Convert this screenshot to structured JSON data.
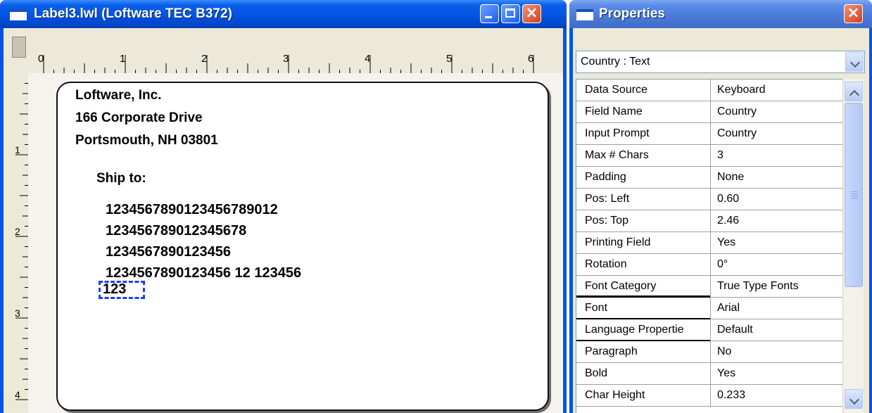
{
  "label_window": {
    "title": "Label3.lwl (Loftware TEC B372)",
    "ruler_numbers": [
      "0",
      "1",
      "2",
      "3",
      "4",
      "5",
      "6"
    ],
    "vruler_numbers": [
      "1",
      "2",
      "3",
      "4"
    ],
    "label_lines": [
      "Loftware, Inc.",
      "166 Corporate Drive",
      "Portsmouth, NH 03801",
      "Ship to:",
      "1234567890123456789012",
      "123456789012345678",
      "1234567890123456",
      "1234567890123456 12  123456",
      "123"
    ]
  },
  "properties_window": {
    "title": "Properties",
    "selector_value": "Country : Text",
    "rows": [
      {
        "key": "Data Source",
        "value": "Keyboard"
      },
      {
        "key": "Field Name",
        "value": "Country"
      },
      {
        "key": "Input Prompt",
        "value": "Country"
      },
      {
        "key": "Max # Chars",
        "value": "3"
      },
      {
        "key": "Padding",
        "value": "None"
      },
      {
        "key": "Pos: Left",
        "value": "0.60"
      },
      {
        "key": "Pos: Top",
        "value": "2.46"
      },
      {
        "key": "Printing Field",
        "value": "Yes"
      },
      {
        "key": "Rotation",
        "value": "0°"
      },
      {
        "key": "Font Category",
        "value": "True Type Fonts"
      },
      {
        "key": "Font",
        "value": "Arial"
      },
      {
        "key": "Language Propertie",
        "value": "Default"
      },
      {
        "key": "Paragraph",
        "value": "No"
      },
      {
        "key": "Bold",
        "value": "Yes"
      },
      {
        "key": "Char Height",
        "value": "0.233"
      }
    ]
  },
  "colors": {
    "titlebar": "#0054e3",
    "selection": "#1e3cff",
    "close_button": "#d2401c"
  },
  "icons": [
    "window-icon",
    "minimize-icon",
    "maximize-icon",
    "close-icon",
    "chevron-down-icon",
    "chevron-up-icon"
  ]
}
